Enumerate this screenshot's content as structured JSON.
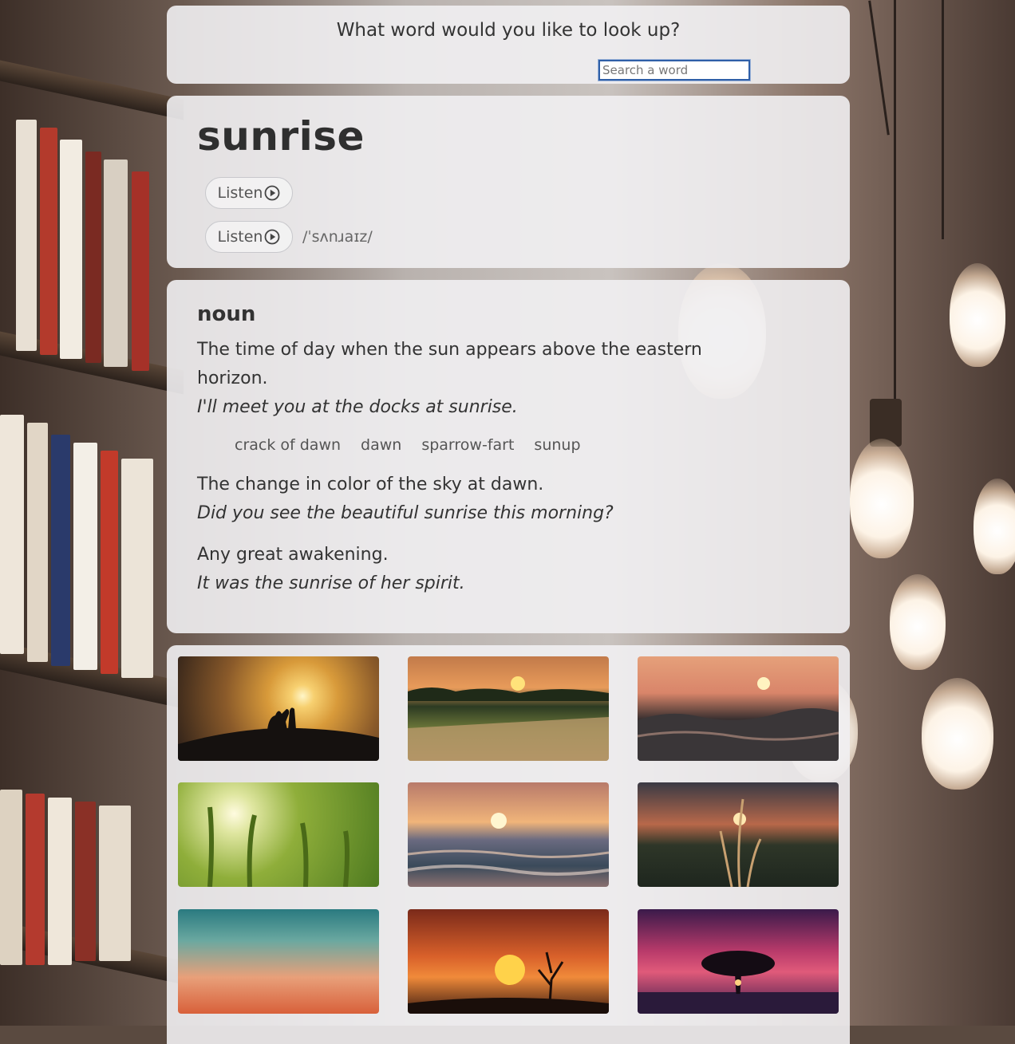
{
  "search": {
    "question": "What word would you like to look up?",
    "placeholder": "Search a word",
    "value": ""
  },
  "word": {
    "text": "sunrise",
    "listen_label": "Listen",
    "phonetic": "/ˈsʌnɹaɪz/"
  },
  "definitions": {
    "part_of_speech": "noun",
    "items": [
      {
        "meaning": "The time of day when the sun appears above the eastern horizon.",
        "example": "I'll meet you at the docks at sunrise."
      },
      {
        "meaning": "The change in color of the sky at dawn.",
        "example": "Did you see the beautiful sunrise this morning?"
      },
      {
        "meaning": "Any great awakening.",
        "example": "It was the sunrise of her spirit."
      }
    ],
    "synonyms": [
      "crack of dawn",
      "dawn",
      "sparrow-fart",
      "sunup"
    ]
  },
  "photos": {
    "items": [
      {
        "name": "couple-silhouette-sunset"
      },
      {
        "name": "grass-field-sunrise"
      },
      {
        "name": "ocean-wave-sunset"
      },
      {
        "name": "wheat-field-sun"
      },
      {
        "name": "sea-sunrise"
      },
      {
        "name": "grass-stalk-sunset"
      },
      {
        "name": "teal-orange-sky"
      },
      {
        "name": "tree-sun-orange-sky"
      },
      {
        "name": "tree-purple-sky"
      }
    ]
  },
  "colors": {
    "input_border": "#2f5fa8",
    "card_bg": "#f1f0f2",
    "text": "#333333"
  }
}
